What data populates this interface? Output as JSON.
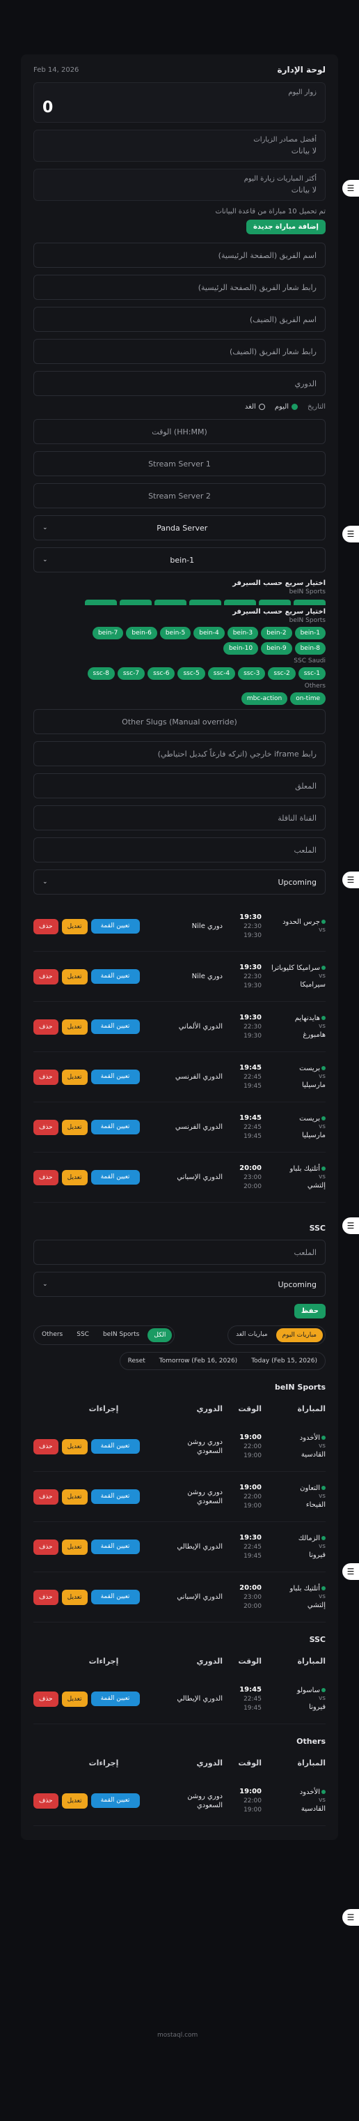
{
  "header": {
    "title": "لوحة الإدارة",
    "date": "Feb 14, 2026"
  },
  "stats": [
    {
      "label": "زوار اليوم",
      "value": "0"
    },
    {
      "label": "أفضل مصادر الزيارات",
      "value": "لا بيانات"
    },
    {
      "label": "أكثر المباريات زيارة اليوم",
      "value": "لا بيانات"
    }
  ],
  "loaded_note": "تم تحميل 10 مباراة من قاعدة البيانات",
  "add_button": "إضافة مباراة جديدة",
  "fields": {
    "home_team": "اسم الفريق (الصفحة الرئيسية)",
    "home_logo": "رابط شعار الفريق (الصفحة الرئيسية)",
    "away_team": "اسم الفريق (الضيف)",
    "away_logo": "رابط شعار الفريق (الضيف)",
    "league": "الدوري",
    "date_label": "التاريخ",
    "today": "اليوم",
    "tomorrow": "الغد",
    "time": "الوقت (HH:MM)",
    "stream1": "Stream Server 1",
    "stream2": "Stream Server 2",
    "server": "Panda Server",
    "channel": "bein-1",
    "quick_pick": "اختيار سريع حسب السيرفر",
    "bein_label": "beIN Sports",
    "ssc_label": "SSC Saudi",
    "others_label": "Others",
    "other_slugs": "Other Slugs (Manual override)",
    "iframe": "رابط iframe خارجي (اتركه فارغاً كبديل احتياطي)",
    "commentator": "المعلق",
    "tv": "القناة الناقلة",
    "stadium": "الملعب",
    "status": "Upcoming",
    "stadium2": "الملعب",
    "status2": "Upcoming"
  },
  "bein_chips": [
    "bein-1",
    "bein-2",
    "bein-3",
    "bein-4",
    "bein-5",
    "bein-6",
    "bein-7",
    "bein-8",
    "bein-9",
    "bein-10"
  ],
  "ssc_chips": [
    "ssc-1",
    "ssc-2",
    "ssc-3",
    "ssc-4",
    "ssc-5",
    "ssc-6",
    "ssc-7",
    "ssc-8"
  ],
  "other_chips": [
    "on-time",
    "mbc-action"
  ],
  "labels": {
    "delete": "حذف",
    "edit": "تعديل",
    "pin": "تعيين القمة",
    "save": "حفظ",
    "ssc": "SSC",
    "vs": "vs"
  },
  "upper_matches": [
    {
      "home": "جرس الحدود",
      "time": "19:30",
      "end": "22:30",
      "start": "19:30",
      "league": "دوري Nile"
    },
    {
      "home": "سراميكا كليوباترا",
      "short": "سيراميكا",
      "time": "19:30",
      "end": "22:30",
      "start": "19:30",
      "league": "دوري Nile"
    },
    {
      "home": "هايدنهايم",
      "short": "هامبورغ",
      "time": "19:30",
      "end": "22:30",
      "start": "19:30",
      "league": "الدوري الألماني"
    },
    {
      "home": "بريست",
      "short": "مارسيليا",
      "time": "19:45",
      "end": "22:45",
      "start": "19:45",
      "league": "الدوري الفرنسي"
    },
    {
      "home": "بريست",
      "short": "مارسيليا",
      "time": "19:45",
      "end": "22:45",
      "start": "19:45",
      "league": "الدوري الفرنسي"
    },
    {
      "home": "أتلتيك بلباو",
      "short": "إلتشي",
      "time": "20:00",
      "end": "23:00",
      "start": "20:00",
      "league": "الدوري الإسباني"
    }
  ],
  "filters": {
    "today_matches": "مباريات اليوم",
    "tomorrow_matches": "مباريات الغد",
    "all": "الكل",
    "bein": "beIN Sports",
    "ssc": "SSC",
    "others": "Others",
    "today_date": "Today (Feb 15, 2026)",
    "tomorrow_date": "Tomorrow (Feb 16, 2026)",
    "reset": "Reset"
  },
  "table_headers": {
    "match": "المباراة",
    "time": "الوقت",
    "league": "الدوري",
    "actions": "إجراءات"
  },
  "bein_matches": [
    {
      "home": "الأخدود",
      "away": "القادسية",
      "time": "19:00",
      "end": "22:00",
      "start": "19:00",
      "league": "دوري روشن السعودي"
    },
    {
      "home": "التعاون",
      "away": "الفيحاء",
      "time": "19:00",
      "end": "22:00",
      "start": "19:00",
      "league": "دوري روشن السعودي"
    },
    {
      "home": "الزمالك",
      "away": "فيرونا",
      "time": "19:30",
      "end": "22:45",
      "start": "19:45",
      "league": "الدوري الإيطالي"
    },
    {
      "home": "أتلتيك بلباو",
      "away": "إلتشي",
      "time": "20:00",
      "end": "23:00",
      "start": "20:00",
      "league": "الدوري الإسباني"
    }
  ],
  "ssc_matches": [
    {
      "home": "ساسولو",
      "away": "فيرونا",
      "time": "19:45",
      "end": "22:45",
      "start": "19:45",
      "league": "الدوري الإيطالي"
    }
  ],
  "other_matches": [
    {
      "home": "الأخدود",
      "away": "القادسية",
      "time": "19:00",
      "end": "22:00",
      "start": "19:00",
      "league": "دوري روشن السعودي"
    }
  ],
  "sections": {
    "bein": "beIN Sports",
    "ssc": "SSC",
    "others": "Others"
  },
  "watermark": "mostaql.com"
}
